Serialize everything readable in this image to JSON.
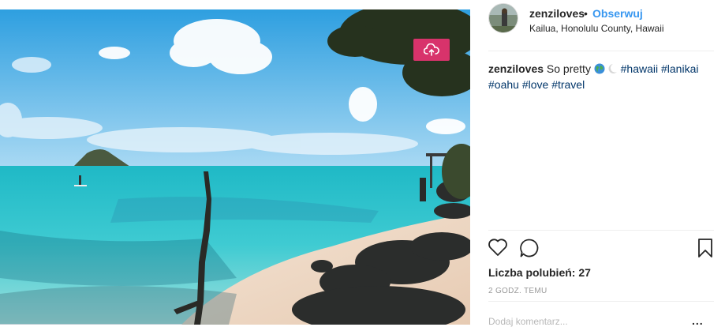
{
  "post": {
    "username": "zenziloves",
    "separator": "•",
    "follow_label": "Obserwuj",
    "location": "Kailua, Honolulu County, Hawaii",
    "caption": {
      "username": "zenziloves",
      "text": "So pretty",
      "emojis": [
        "globe-icon",
        "crescent-moon-icon"
      ],
      "hashtags": [
        "#hawaii",
        "#lanikai",
        "#oahu",
        "#love",
        "#travel"
      ]
    },
    "likes_label": "Liczba polubień: 27",
    "timestamp": "2 GODZ. TEMU",
    "comment_placeholder": "Dodaj komentarz...",
    "more_label": "..."
  },
  "icons": {
    "save_to_cloud": "cloud-upload-icon",
    "like": "heart-icon",
    "comment": "comment-bubble-icon",
    "bookmark": "bookmark-icon"
  },
  "colors": {
    "link_blue": "#3897f0",
    "hashtag": "#003569",
    "save_button": "#d8336b",
    "muted_text": "#999999"
  }
}
